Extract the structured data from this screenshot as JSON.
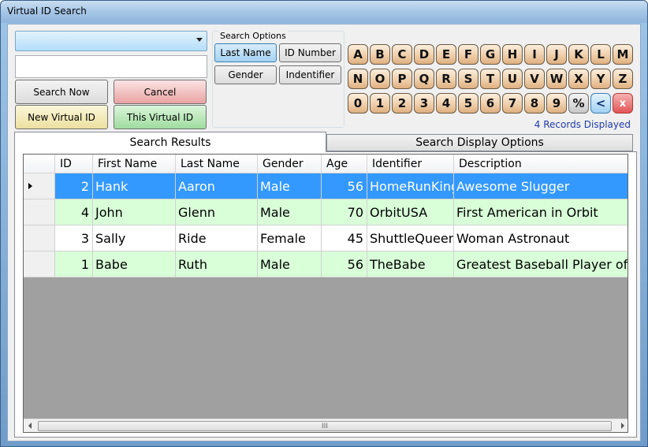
{
  "window": {
    "title": "Virtual ID Search"
  },
  "search": {
    "combo_value": "",
    "text_value": ""
  },
  "buttons": {
    "search_now": "Search Now",
    "cancel": "Cancel",
    "new_virtual_id": "New Virtual ID",
    "this_virtual_id": "This Virtual ID"
  },
  "search_options": {
    "title": "Search Options",
    "last_name": "Last Name",
    "id_number": "ID Number",
    "gender": "Gender",
    "identifier": "Indentifier",
    "selected": "Last Name"
  },
  "keypad": {
    "row1": [
      "A",
      "B",
      "C",
      "D",
      "E",
      "F",
      "G",
      "H",
      "I",
      "J",
      "K",
      "L",
      "M"
    ],
    "row2": [
      "N",
      "O",
      "P",
      "Q",
      "R",
      "S",
      "T",
      "U",
      "V",
      "W",
      "X",
      "Y",
      "Z"
    ],
    "row3": [
      "0",
      "1",
      "2",
      "3",
      "4",
      "5",
      "6",
      "7",
      "8",
      "9",
      "%",
      "<",
      "x"
    ],
    "records_displayed": "4 Records Displayed"
  },
  "tabs": {
    "results": "Search Results",
    "display_options": "Search Display Options",
    "active": "Search Results"
  },
  "grid": {
    "columns": [
      "ID",
      "First Name",
      "Last Name",
      "Gender",
      "Age",
      "Identifier",
      "Description"
    ],
    "rows": [
      [
        "2",
        "Hank",
        "Aaron",
        "Male",
        "56",
        "HomeRunKing",
        "Awesome Slugger"
      ],
      [
        "4",
        "John",
        "Glenn",
        "Male",
        "70",
        "OrbitUSA",
        "First American in Orbit"
      ],
      [
        "3",
        "Sally",
        "Ride",
        "Female",
        "45",
        "ShuttleQueen",
        "Woman Astronaut"
      ],
      [
        "1",
        "Babe",
        "Ruth",
        "Male",
        "56",
        "TheBabe",
        "Greatest Baseball Player of All T"
      ]
    ],
    "selected_row": 0,
    "scroll_grip": "III"
  },
  "colors": {
    "selected_row": "#3399ff",
    "alt_row": "#d9ffd9",
    "records_text": "#1f3aa8"
  }
}
